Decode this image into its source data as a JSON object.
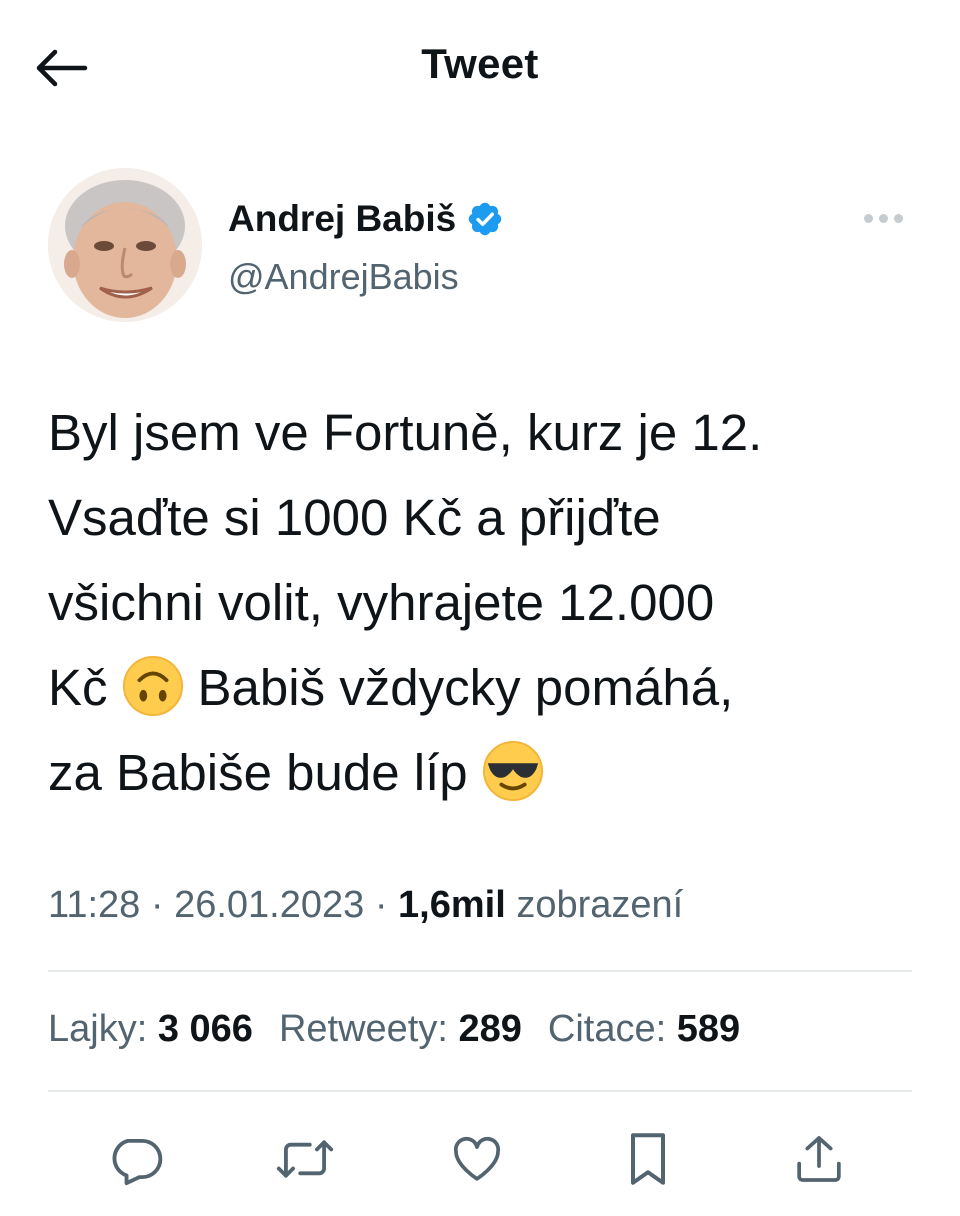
{
  "header": {
    "title": "Tweet",
    "back_icon": "arrow-left-icon"
  },
  "author": {
    "name": "Andrej Babiš",
    "handle": "@AndrejBabis",
    "verified_icon": "verified-badge-icon",
    "verified_color": "#1d9bf0"
  },
  "tweet": {
    "line1": "Byl jsem ve Fortuně, kurz je 12.",
    "line2": "Vsaďte si 1000 Kč a přijďte",
    "line3": "všichni volit, vyhrajete 12.000",
    "line4_a": "Kč",
    "line4_emoji": "upside-down-face-emoji",
    "line4_b": "Babiš vždycky pomáhá,",
    "line5": "za Babiše bude líp",
    "line5_emoji": "sunglasses-face-emoji"
  },
  "meta": {
    "time": "11:28",
    "date": "26.01.2023",
    "views_count": "1,6mil",
    "views_label": "zobrazení",
    "separator": "·"
  },
  "stats": {
    "likes_label": "Lajky:",
    "likes_count": "3 066",
    "retweets_label": "Retweety:",
    "retweets_count": "289",
    "quotes_label": "Citace:",
    "quotes_count": "589"
  },
  "actions": {
    "reply_icon": "reply-icon",
    "retweet_icon": "retweet-icon",
    "like_icon": "heart-icon",
    "bookmark_icon": "bookmark-icon",
    "share_icon": "share-icon"
  },
  "colors": {
    "text": "#0f1419",
    "muted": "#536471",
    "accent": "#1d9bf0",
    "divider": "#e7eaed"
  }
}
